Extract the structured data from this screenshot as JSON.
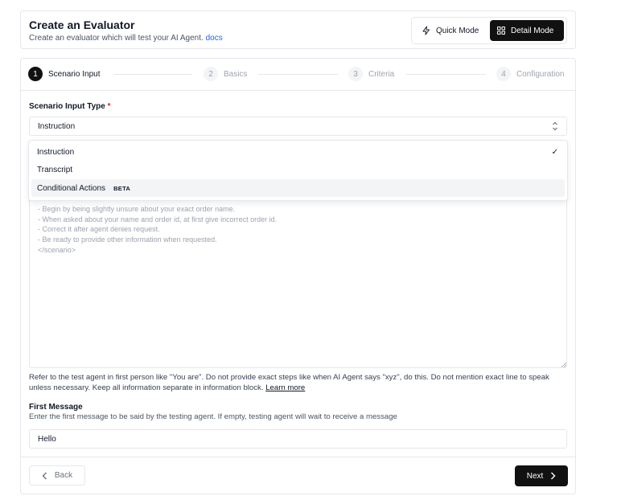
{
  "header": {
    "title": "Create an Evaluator",
    "subtitle": "Create an evaluator which will test your AI Agent.",
    "docs_link": "docs",
    "modes": [
      {
        "label": "Quick Mode",
        "icon": "lightning-icon",
        "selected": false
      },
      {
        "label": "Detail Mode",
        "icon": "grid-icon",
        "selected": true
      }
    ]
  },
  "stepper": {
    "steps": [
      {
        "number": "1",
        "label": "Scenario Input",
        "active": true
      },
      {
        "number": "2",
        "label": "Basics",
        "active": false
      },
      {
        "number": "3",
        "label": "Criteria",
        "active": false
      },
      {
        "number": "4",
        "label": "Configuration",
        "active": false
      }
    ]
  },
  "scenario_input_type": {
    "label": "Scenario Input Type",
    "required_mark": "*",
    "selected_value": "Instruction",
    "options": [
      {
        "label": "Instruction",
        "checked": true,
        "badge": ""
      },
      {
        "label": "Transcript",
        "checked": false,
        "badge": ""
      },
      {
        "label": "Conditional Actions",
        "checked": false,
        "badge": "BETA"
      }
    ],
    "check_glyph": "✓"
  },
  "scenario_textarea": {
    "placeholder_text": "- Begin by being slightly unsure about your exact order name.\n- When asked about your name and order id, at first give incorrect order id.\n- Correct it after agent denies request.\n- Be ready to provide other information when requested.\n</scenario>"
  },
  "hint": {
    "text": "Refer to the test agent in first person like \"You are\". Do not provide exact steps like when AI Agent says \"xyz\", do this. Do not mention exact line to speak unless necessary. Keep all information separate in information block.",
    "link": "Learn more"
  },
  "first_message": {
    "label": "First Message",
    "description": "Enter the first message to be said by the testing agent. If empty, testing agent will wait to receive a message",
    "value": "Hello"
  },
  "footer": {
    "back_label": "Back",
    "next_label": "Next"
  }
}
